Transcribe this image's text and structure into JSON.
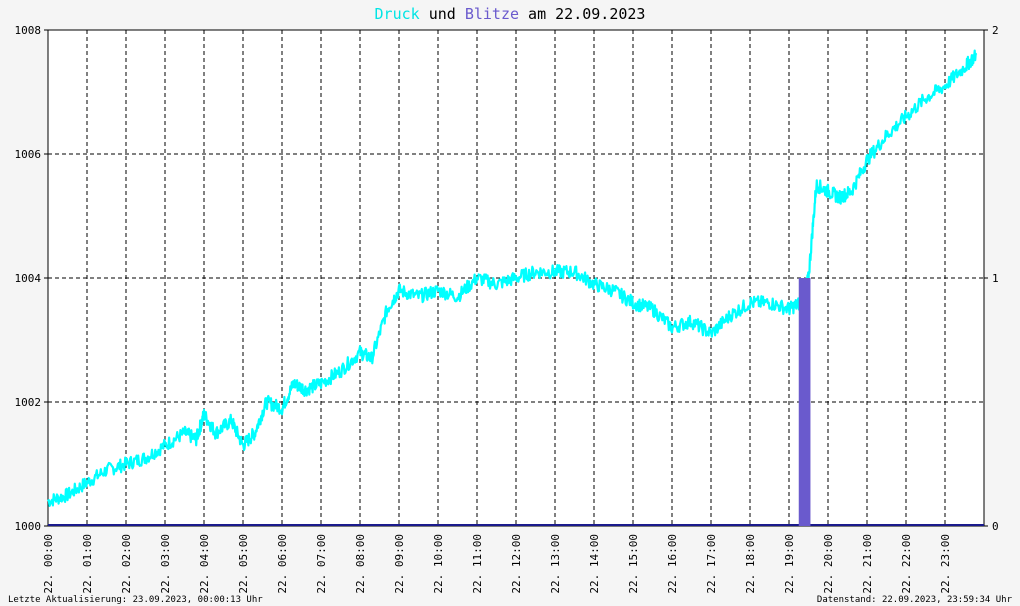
{
  "title": {
    "parts": [
      {
        "text": "Druck",
        "color": "#00e5e5"
      },
      {
        "text": " und ",
        "color": "#000000"
      },
      {
        "text": "Blitze",
        "color": "#6a5acd"
      },
      {
        "text": " am 22.09.2023",
        "color": "#000000"
      }
    ]
  },
  "footer": {
    "left": "Letzte Aktualisierung: 23.09.2023, 00:00:13 Uhr",
    "right": "Datenstand: 22.09.2023, 23:59:34 Uhr"
  },
  "chart_data": {
    "type": "line",
    "xlim": [
      0,
      24
    ],
    "ylim": [
      1000,
      1008
    ],
    "y2lim": [
      0,
      2
    ],
    "yticks": [
      "1000",
      "1002",
      "1004",
      "1006",
      "1008"
    ],
    "y2ticks": [
      "0",
      "1",
      "2"
    ],
    "xticks": [
      "22. 00:00",
      "22. 01:00",
      "22. 02:00",
      "22. 03:00",
      "22. 04:00",
      "22. 05:00",
      "22. 06:00",
      "22. 07:00",
      "22. 08:00",
      "22. 09:00",
      "22. 10:00",
      "22. 11:00",
      "22. 12:00",
      "22. 13:00",
      "22. 14:00",
      "22. 15:00",
      "22. 16:00",
      "22. 17:00",
      "22. 18:00",
      "22. 19:00",
      "22. 20:00",
      "22. 21:00",
      "22. 22:00",
      "22. 23:00"
    ],
    "grid": true,
    "series": [
      {
        "name": "Druck",
        "axis": "left",
        "color": "#00ffff",
        "x": [
          0,
          0.5,
          1,
          1.5,
          2,
          2.5,
          3,
          3.5,
          3.8,
          4,
          4.3,
          4.7,
          5,
          5.3,
          5.6,
          6,
          6.3,
          6.6,
          7,
          7.5,
          8,
          8.3,
          8.7,
          9,
          9.5,
          10,
          10.5,
          11,
          11.5,
          12,
          12.5,
          13,
          13.5,
          14,
          14.5,
          15,
          15.5,
          16,
          16.5,
          17,
          17.5,
          18,
          18.5,
          19,
          19.3,
          19.5,
          19.7,
          20,
          20.3,
          20.6,
          21,
          21.5,
          22,
          22.5,
          23,
          23.5,
          23.8
        ],
        "y": [
          1000.4,
          1000.5,
          1000.7,
          1000.9,
          1001.0,
          1001.1,
          1001.3,
          1001.5,
          1001.4,
          1001.8,
          1001.5,
          1001.7,
          1001.3,
          1001.5,
          1002.0,
          1001.9,
          1002.3,
          1002.2,
          1002.3,
          1002.5,
          1002.8,
          1002.7,
          1003.5,
          1003.8,
          1003.7,
          1003.8,
          1003.7,
          1004.0,
          1003.9,
          1004.0,
          1004.1,
          1004.1,
          1004.1,
          1003.9,
          1003.8,
          1003.6,
          1003.5,
          1003.2,
          1003.3,
          1003.1,
          1003.4,
          1003.6,
          1003.6,
          1003.5,
          1003.6,
          1004.0,
          1005.5,
          1005.4,
          1005.3,
          1005.4,
          1005.9,
          1006.3,
          1006.6,
          1006.9,
          1007.1,
          1007.4,
          1007.6
        ]
      },
      {
        "name": "Blitze",
        "axis": "right",
        "color": "#6a5acd",
        "x": [
          0,
          19.25,
          19.3,
          19.4,
          19.5,
          19.55,
          24
        ],
        "y": [
          0,
          0,
          0.5,
          0.9,
          1.0,
          0,
          0
        ]
      }
    ]
  }
}
